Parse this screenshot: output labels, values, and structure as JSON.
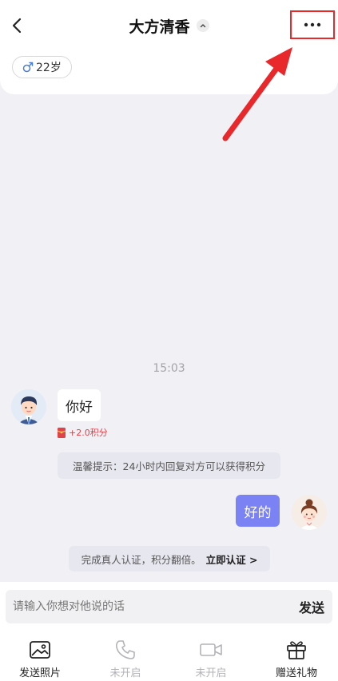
{
  "header": {
    "back_icon": "chevron-left-icon",
    "title": "大方清香",
    "title_caret_icon": "chevron-up-icon",
    "more_icon": "more-horizontal-icon",
    "tag_icon": "male-symbol-icon",
    "tag_age": "22岁"
  },
  "annotation": {
    "color": "#e8282b"
  },
  "chat": {
    "time": "15:03",
    "incoming_message": "你好",
    "points_icon": "red-packet-icon",
    "points_text": "+2.0积分",
    "tip": "温馨提示：24小时内回复对方可以获得积分",
    "outgoing_message": "好的",
    "verify_text": "完成真人认证，积分翻倍。",
    "verify_link": "立即认证 >"
  },
  "input": {
    "placeholder": "请输入你想对他说的话",
    "value": "",
    "send_label": "发送"
  },
  "toolbar": {
    "items": [
      {
        "icon": "image-icon",
        "label": "发送照片",
        "enabled": true
      },
      {
        "icon": "phone-icon",
        "label": "未开启",
        "enabled": false
      },
      {
        "icon": "video-camera-icon",
        "label": "未开启",
        "enabled": false
      },
      {
        "icon": "gift-icon",
        "label": "赠送礼物",
        "enabled": true
      }
    ]
  },
  "colors": {
    "accent": "#7b82f3",
    "background": "#f1f0f5",
    "points": "#e0424a"
  }
}
